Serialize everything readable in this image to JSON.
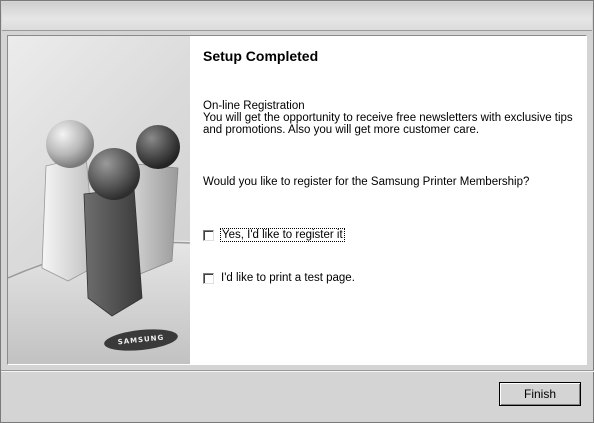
{
  "content": {
    "title": "Setup Completed",
    "registration_heading": "On-line Registration",
    "registration_line1": "You will get the opportunity to receive free newsletters with exclusive tips",
    "registration_line2": "and promotions. Also you will get more customer care.",
    "question": "Would you like to register for the Samsung Printer Membership?",
    "checkboxes": [
      {
        "label": "Yes, I'd like to register it",
        "checked": false
      },
      {
        "label": "I'd like to print a test page.",
        "checked": false
      }
    ]
  },
  "side_panel": {
    "logo_text": "SAMSUNG"
  },
  "footer": {
    "finish_label": "Finish"
  }
}
